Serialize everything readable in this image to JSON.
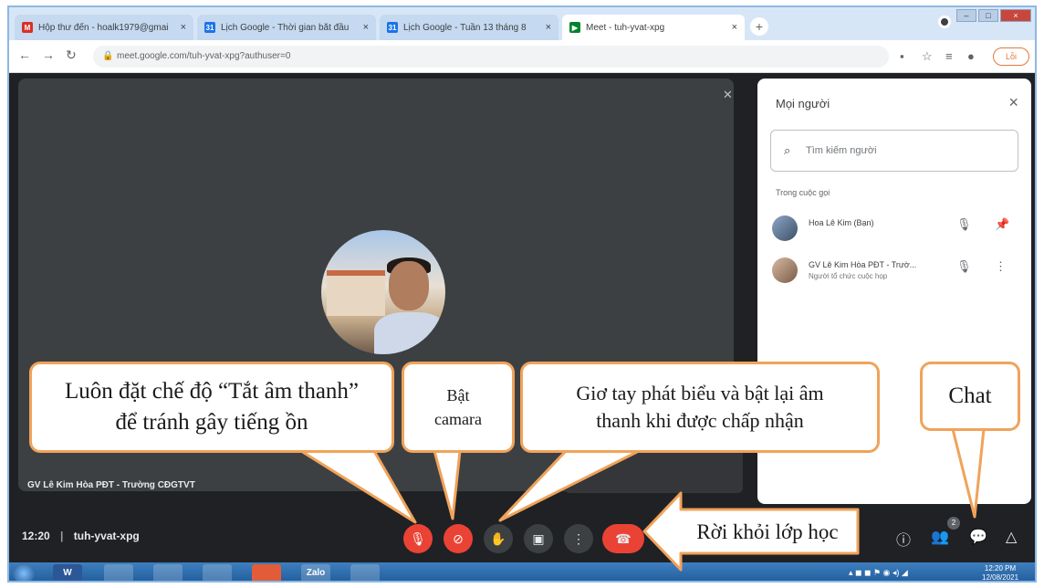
{
  "browser": {
    "tabs": [
      {
        "title": "Hộp thư đến - hoalk1979@gmai",
        "favicon_letter": "M",
        "favicon_color": "#d93025"
      },
      {
        "title": "Lịch Google - Thời gian bắt đầu",
        "favicon_letter": "31",
        "favicon_color": "#1a73e8"
      },
      {
        "title": "Lịch Google - Tuần 13 tháng 8",
        "favicon_letter": "31",
        "favicon_color": "#1a73e8"
      },
      {
        "title": "Meet - tuh-yvat-xpg",
        "favicon_letter": "▶",
        "favicon_color": "#00832d"
      }
    ],
    "tab_close": "×",
    "new_tab": "+",
    "url": "meet.google.com/tuh-yvat-xpg?authuser=0",
    "update_label": "Lỗi",
    "window_controls": {
      "minimize": "–",
      "maximize": "□",
      "close": "×"
    }
  },
  "meet": {
    "stage_participant_name": "GV Lê Kim Hòa PĐT - Trường CĐGTVT",
    "people_panel": {
      "title": "Mọi người",
      "close": "×",
      "search_placeholder": "Tìm kiếm người",
      "section_label": "Trong cuộc gọi",
      "participants": [
        {
          "name": "Hoa Lê Kim (Bạn)",
          "role": ""
        },
        {
          "name": "GV Lê Kim Hòa PĐT - Trườ...",
          "role": "Người tổ chức cuộc họp"
        }
      ]
    },
    "bottom_bar": {
      "time": "12:20",
      "meeting_code": "tuh-yvat-xpg",
      "people_count": "2"
    }
  },
  "taskbar": {
    "apps": [
      "W",
      "",
      "",
      "",
      "",
      "Zalo",
      ""
    ],
    "clock_time": "12:20 PM",
    "clock_date": "12/08/2021"
  },
  "callouts": {
    "mute": "Luôn đặt chế độ “Tắt âm thanh” để tránh gây tiếng ồn",
    "camera": "Bật camara",
    "raise_hand": "Giơ tay phát biểu và bật lại âm thanh khi được chấp nhận",
    "chat": "Chat",
    "leave": "Rời khỏi lớp học"
  },
  "colors": {
    "callout_border": "#f0a35a",
    "meet_red": "#ea4335",
    "meet_dark": "#202124"
  }
}
